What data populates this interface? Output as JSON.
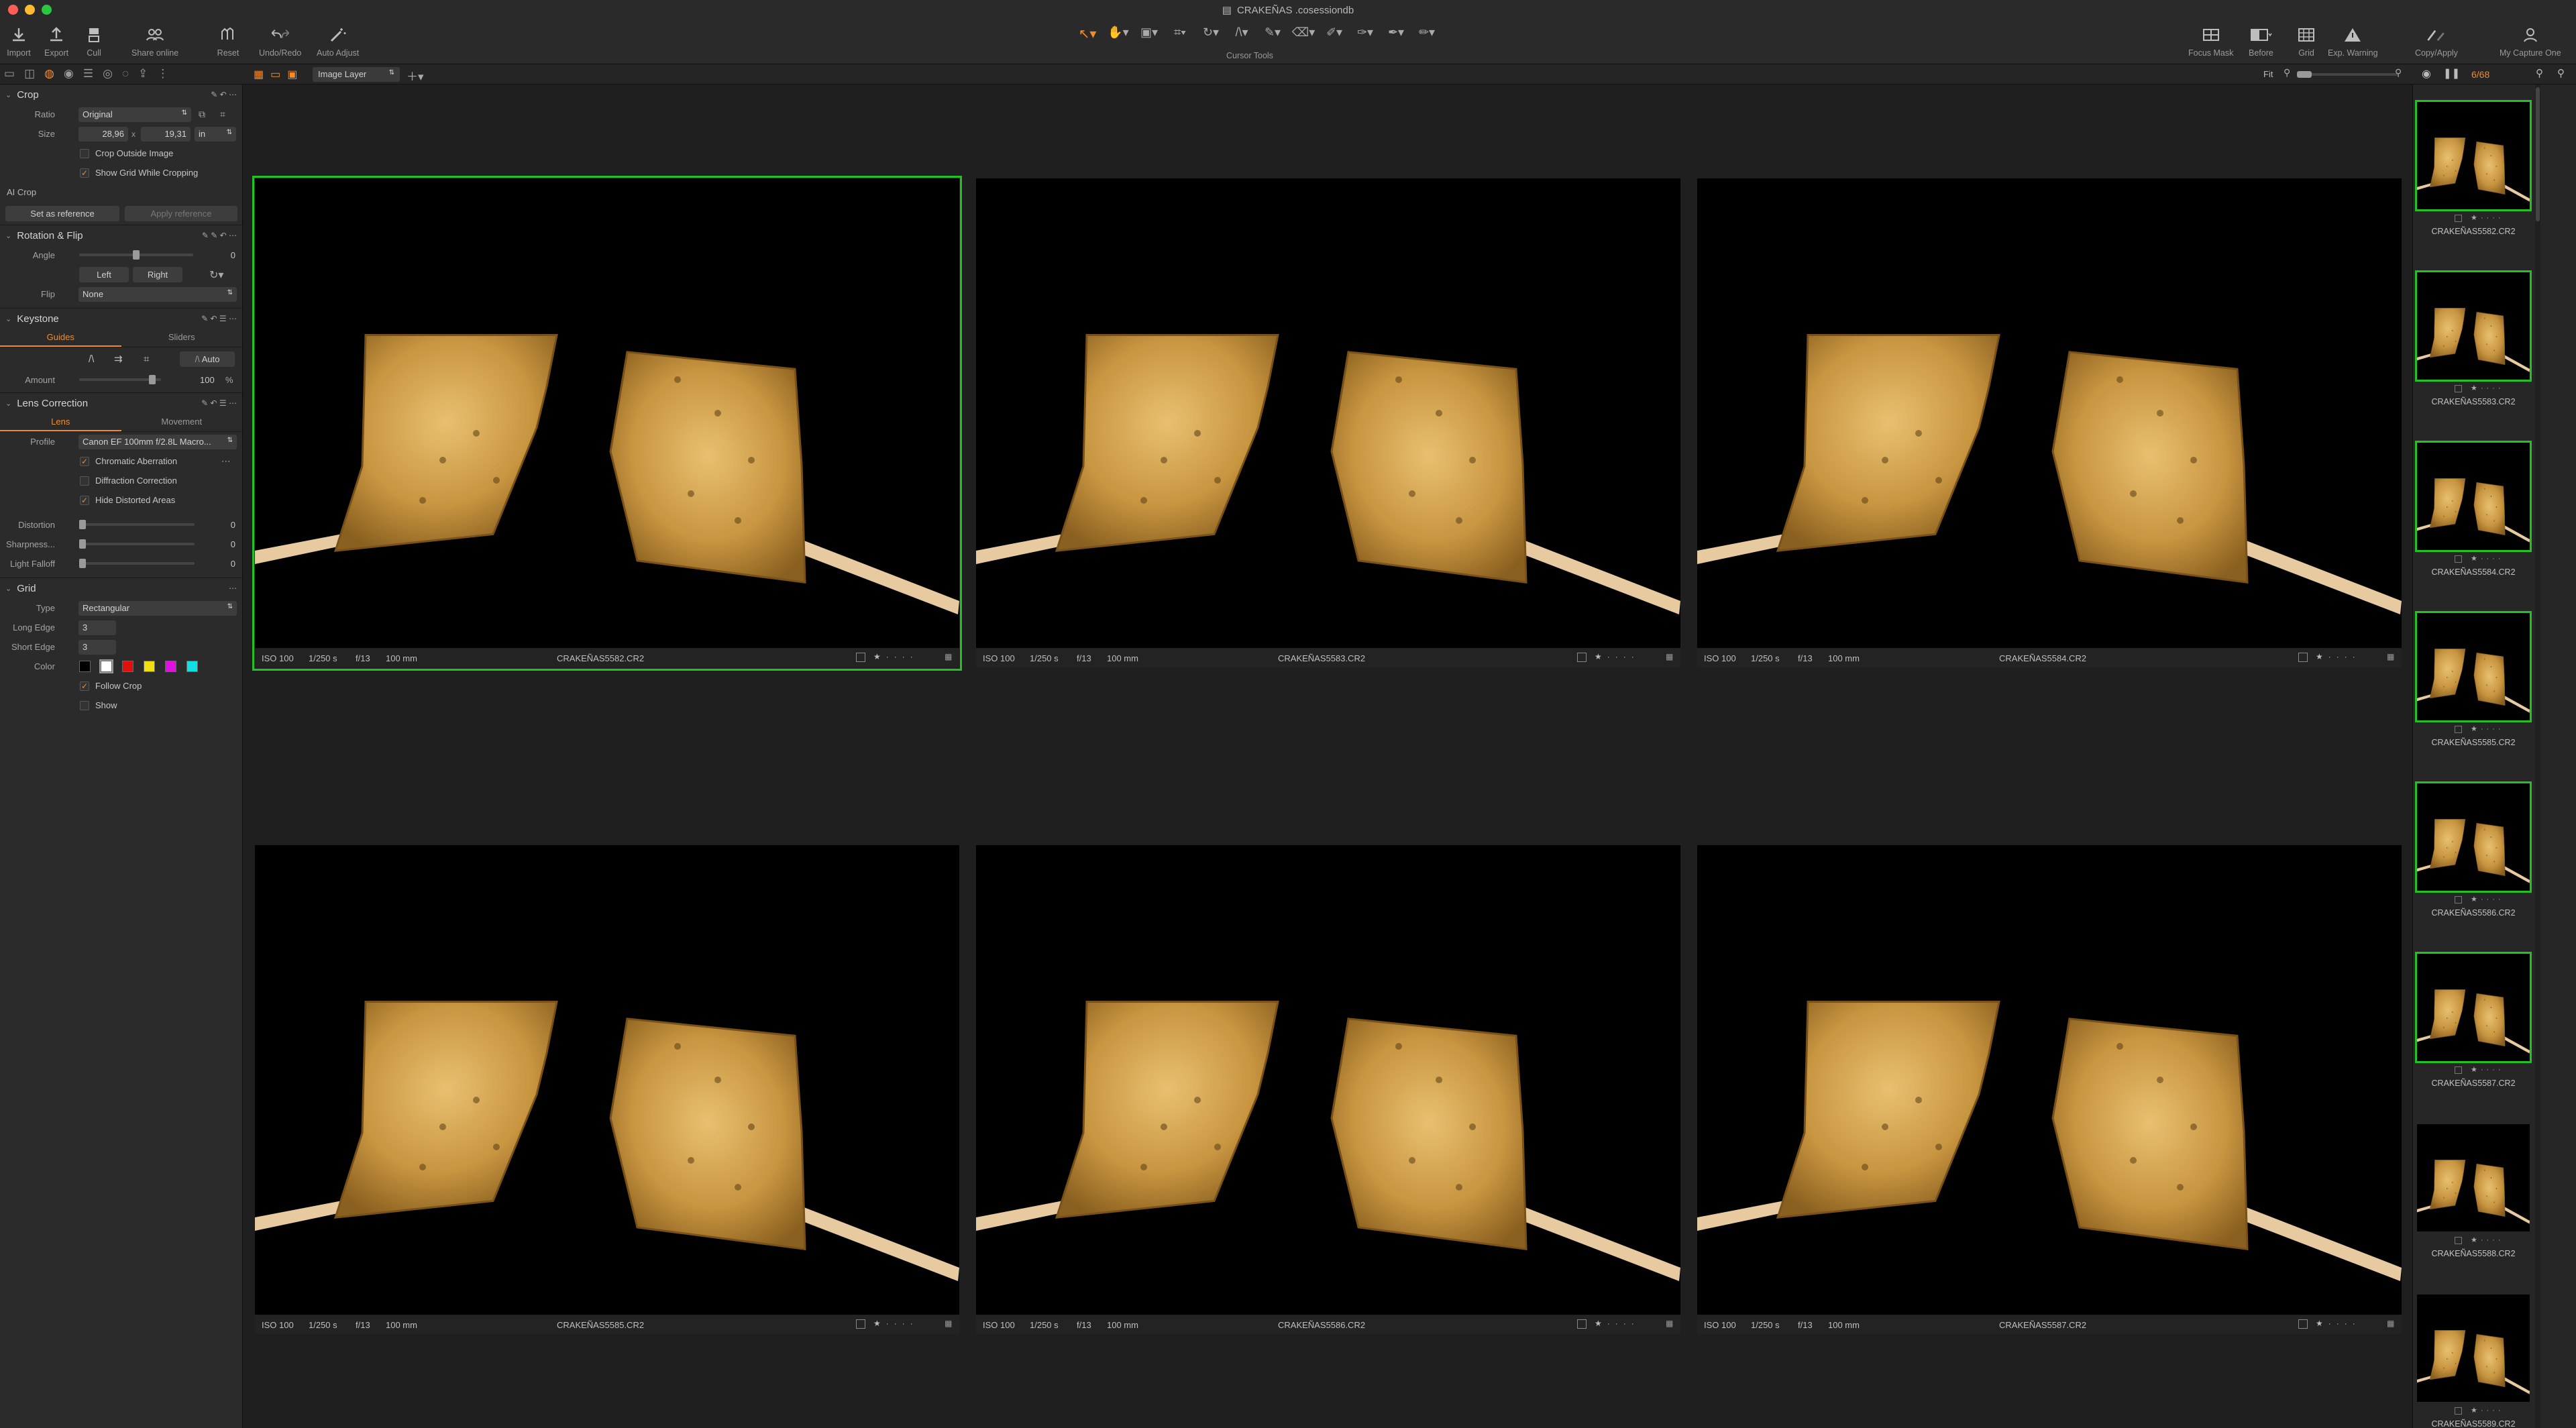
{
  "window": {
    "title": "CRAKEÑAS .cosessiondb"
  },
  "toolbar": {
    "import": "Import",
    "export": "Export",
    "cull": "Cull",
    "share": "Share online",
    "reset": "Reset",
    "undo_redo": "Undo/Redo",
    "auto_adjust": "Auto Adjust",
    "cursor_tools": "Cursor Tools",
    "focus_mask": "Focus Mask",
    "before": "Before",
    "grid": "Grid",
    "exp_warning": "Exp. Warning",
    "copy_apply": "Copy/Apply",
    "my_capture": "My Capture One"
  },
  "subbar": {
    "layer": "Image Layer",
    "fit": "Fit",
    "counter": "6/68"
  },
  "crop": {
    "title": "Crop",
    "ratio_label": "Ratio",
    "ratio_value": "Original",
    "size_label": "Size",
    "width": "28,96",
    "x": "x",
    "height": "19,31",
    "unit": "in",
    "outside": "Crop Outside Image",
    "show_grid": "Show Grid While Cropping",
    "ai_crop": "AI Crop",
    "set_ref": "Set as reference",
    "apply_ref": "Apply reference"
  },
  "rotation": {
    "title": "Rotation & Flip",
    "angle_label": "Angle",
    "angle_value": "0",
    "left": "Left",
    "right": "Right",
    "flip_label": "Flip",
    "flip_value": "None"
  },
  "keystone": {
    "title": "Keystone",
    "tab_guides": "Guides",
    "tab_sliders": "Sliders",
    "auto": "Auto",
    "amount_label": "Amount",
    "amount_value": "100",
    "pct": "%"
  },
  "lens": {
    "title": "Lens Correction",
    "tab_lens": "Lens",
    "tab_movement": "Movement",
    "profile_label": "Profile",
    "profile_value": "Canon EF 100mm f/2.8L Macro...",
    "chromatic": "Chromatic Aberration",
    "diffraction": "Diffraction Correction",
    "hide_distorted": "Hide Distorted Areas",
    "distortion_label": "Distortion",
    "distortion_value": "0",
    "sharpness_label": "Sharpness...",
    "sharpness_value": "0",
    "falloff_label": "Light Falloff",
    "falloff_value": "0"
  },
  "grid_tool": {
    "title": "Grid",
    "type_label": "Type",
    "type_value": "Rectangular",
    "long_label": "Long Edge",
    "long_value": "3",
    "short_label": "Short Edge",
    "short_value": "3",
    "color_label": "Color",
    "follow_crop": "Follow Crop",
    "show": "Show",
    "swatches": [
      "#000000",
      "#ffffff",
      "#e01010",
      "#f0e010",
      "#e010e0",
      "#10e0e0"
    ]
  },
  "viewer": {
    "iso": "ISO 100",
    "shutter": "1/250 s",
    "aperture": "f/13",
    "focal": "100 mm",
    "images": [
      "CRAKEÑAS5582.CR2",
      "CRAKEÑAS5583.CR2",
      "CRAKEÑAS5584.CR2",
      "CRAKEÑAS5585.CR2",
      "CRAKEÑAS5586.CR2",
      "CRAKEÑAS5587.CR2"
    ]
  },
  "browser": {
    "thumbs": [
      "CRAKEÑAS5582.CR2",
      "CRAKEÑAS5583.CR2",
      "CRAKEÑAS5584.CR2",
      "CRAKEÑAS5585.CR2",
      "CRAKEÑAS5586.CR2",
      "CRAKEÑAS5587.CR2",
      "CRAKEÑAS5588.CR2",
      "CRAKEÑAS5589.CR2"
    ]
  },
  "colors": {
    "accent": "#f28c28",
    "selected": "#25c025",
    "panel": "#2b2b2b"
  }
}
